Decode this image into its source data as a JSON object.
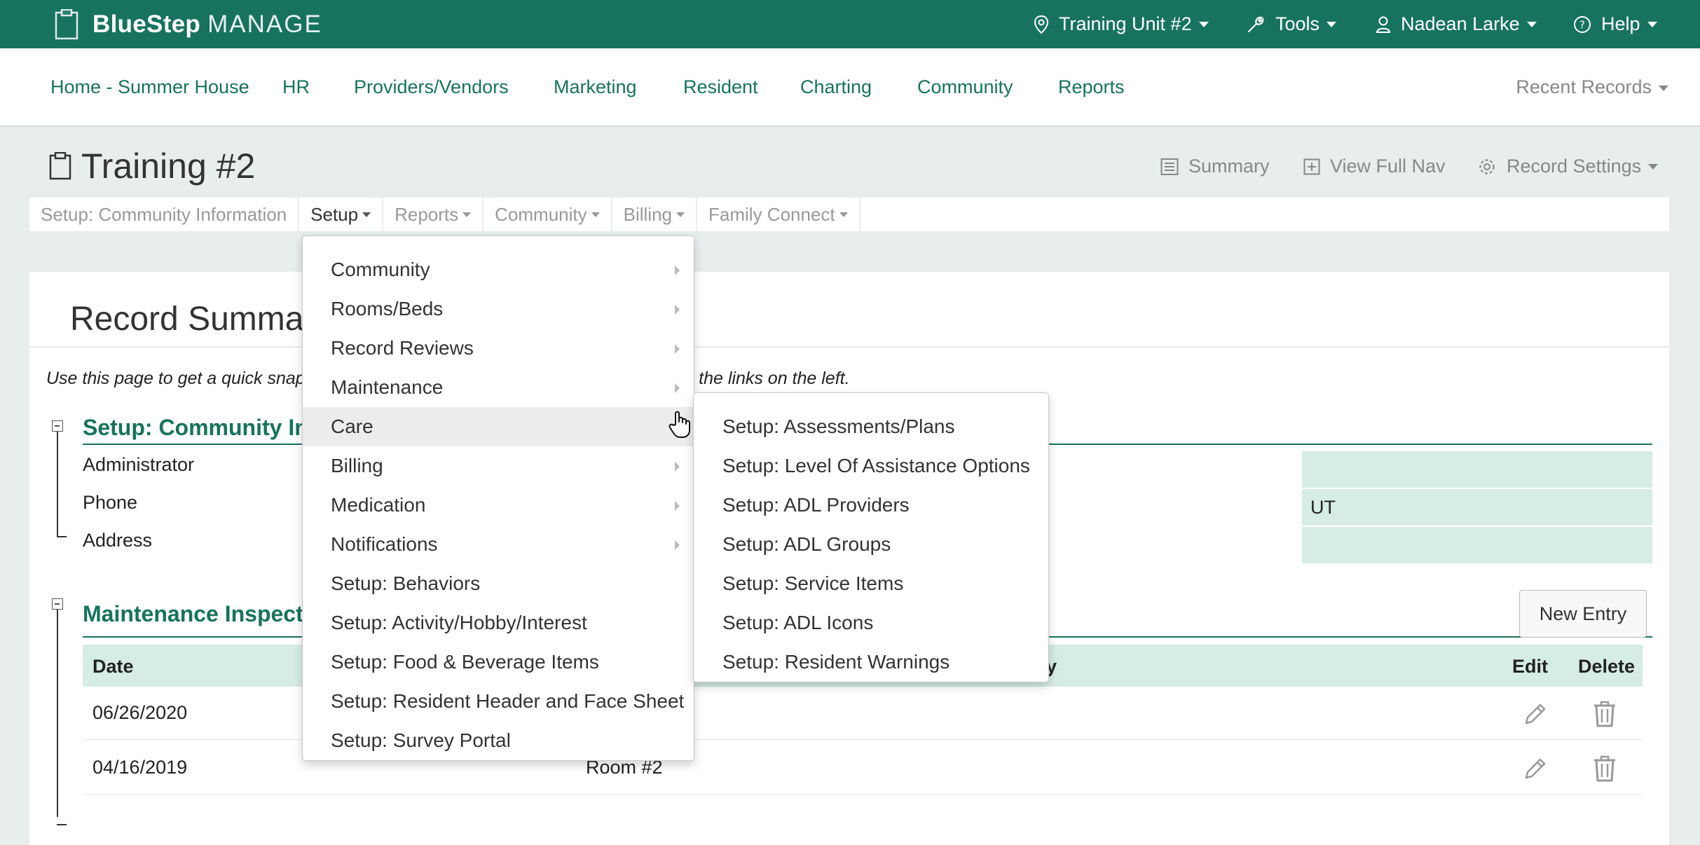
{
  "brand": {
    "name": "BlueStep",
    "product": "MANAGE"
  },
  "topnav": {
    "location": "Training Unit #2",
    "tools": "Tools",
    "user": "Nadean Larke",
    "help": "Help"
  },
  "mainnav": {
    "items": [
      "Home - Summer House",
      "HR",
      "Providers/Vendors",
      "Marketing",
      "Resident",
      "Charting",
      "Community",
      "Reports"
    ],
    "recent": "Recent Records"
  },
  "record": {
    "title": "Training #2",
    "actions": {
      "summary": "Summary",
      "full_nav": "View Full Nav",
      "settings": "Record Settings"
    }
  },
  "subnav": [
    "Setup: Community Information",
    "Setup",
    "Reports",
    "Community",
    "Billing",
    "Family Connect"
  ],
  "panel": {
    "title": "Record Summary",
    "intro_left": "Use this page to get a quick snapsh",
    "intro_right": "e, use the links on the left."
  },
  "section1": {
    "title": "Setup: Community Info",
    "fields": [
      "Administrator",
      "Phone",
      "Address"
    ],
    "state_value": "UT"
  },
  "section2": {
    "title": "Maintenance Inspectio",
    "new_entry": "New Entry",
    "columns": {
      "date": "Date",
      "tail": "y",
      "edit": "Edit",
      "delete": "Delete"
    },
    "rows": [
      {
        "date": "06/26/2020",
        "room": ""
      },
      {
        "date": "04/16/2019",
        "room": "Room #2"
      }
    ]
  },
  "setup_menu": {
    "items": [
      {
        "label": "Community",
        "submenu": true
      },
      {
        "label": "Rooms/Beds",
        "submenu": true
      },
      {
        "label": "Record Reviews",
        "submenu": true
      },
      {
        "label": "Maintenance",
        "submenu": true
      },
      {
        "label": "Care",
        "submenu": true
      },
      {
        "label": "Billing",
        "submenu": true
      },
      {
        "label": "Medication",
        "submenu": true
      },
      {
        "label": "Notifications",
        "submenu": true
      },
      {
        "label": "Setup: Behaviors",
        "submenu": false
      },
      {
        "label": "Setup: Activity/Hobby/Interest",
        "submenu": false
      },
      {
        "label": "Setup: Food & Beverage Items",
        "submenu": false
      },
      {
        "label": "Setup: Resident Header and Face Sheet",
        "submenu": false
      },
      {
        "label": "Setup: Survey Portal",
        "submenu": false
      }
    ],
    "hovered": "Care"
  },
  "care_submenu": {
    "items": [
      "Setup: Assessments/Plans",
      "Setup: Level Of Assistance Options",
      "Setup: ADL Providers",
      "Setup: ADL Groups",
      "Setup: Service Items",
      "Setup: ADL Icons",
      "Setup: Resident Warnings"
    ]
  },
  "colors": {
    "brand": "#17735e",
    "field_bg": "#d6ece6",
    "page_bg": "#e8edee"
  }
}
